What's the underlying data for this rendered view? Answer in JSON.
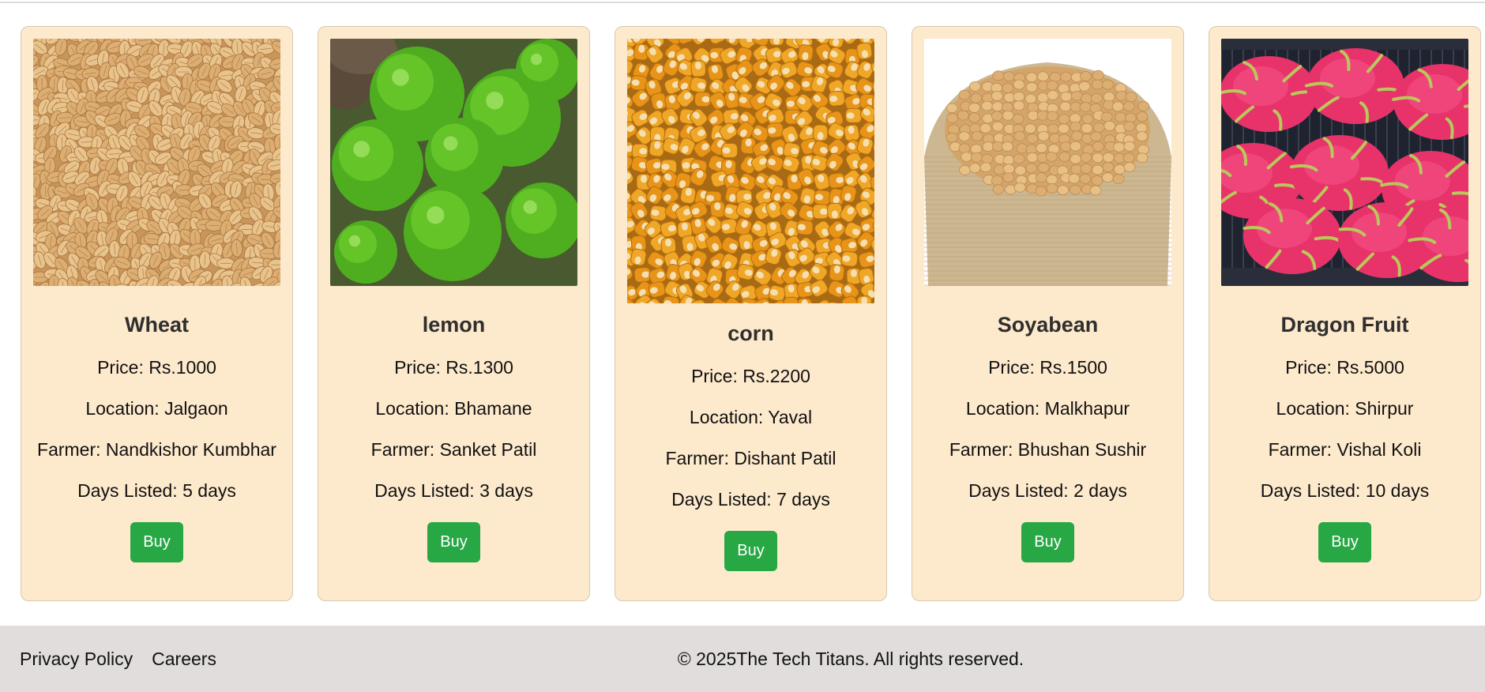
{
  "products": [
    {
      "name": "Wheat",
      "price_label": "Price:",
      "price": "Rs.1000",
      "location_label": "Location:",
      "location": "Jalgaon",
      "farmer_label": "Farmer:",
      "farmer": "Nandkishor Kumbhar",
      "days_label": "Days Listed:",
      "days": "5 days",
      "buy_label": "Buy",
      "image_icon": "wheat-grains-image"
    },
    {
      "name": "lemon",
      "price_label": "Price:",
      "price": "Rs.1300",
      "location_label": "Location:",
      "location": "Bhamane",
      "farmer_label": "Farmer:",
      "farmer": "Sanket Patil",
      "days_label": "Days Listed:",
      "days": "3 days",
      "buy_label": "Buy",
      "image_icon": "limes-image"
    },
    {
      "name": "corn",
      "price_label": "Price:",
      "price": "Rs.2200",
      "location_label": "Location:",
      "location": "Yaval",
      "farmer_label": "Farmer:",
      "farmer": "Dishant Patil",
      "days_label": "Days Listed:",
      "days": "7 days",
      "buy_label": "Buy",
      "image_icon": "corn-kernels-image"
    },
    {
      "name": "Soyabean",
      "price_label": "Price:",
      "price": "Rs.1500",
      "location_label": "Location:",
      "location": "Malkhapur",
      "farmer_label": "Farmer:",
      "farmer": "Bhushan Sushir",
      "days_label": "Days Listed:",
      "days": "2 days",
      "buy_label": "Buy",
      "image_icon": "soybean-sack-image"
    },
    {
      "name": "Dragon Fruit",
      "price_label": "Price:",
      "price": "Rs.5000",
      "location_label": "Location:",
      "location": "Shirpur",
      "farmer_label": "Farmer:",
      "farmer": "Vishal Koli",
      "days_label": "Days Listed:",
      "days": "10 days",
      "buy_label": "Buy",
      "image_icon": "dragon-fruit-image"
    }
  ],
  "footer": {
    "links": [
      "Privacy Policy",
      "Careers"
    ],
    "copyright": "© 2025The Tech Titans. All rights reserved."
  },
  "colors": {
    "card_bg": "#fde9cc",
    "buy_button": "#28a745",
    "footer_bg": "#e2dddd"
  }
}
